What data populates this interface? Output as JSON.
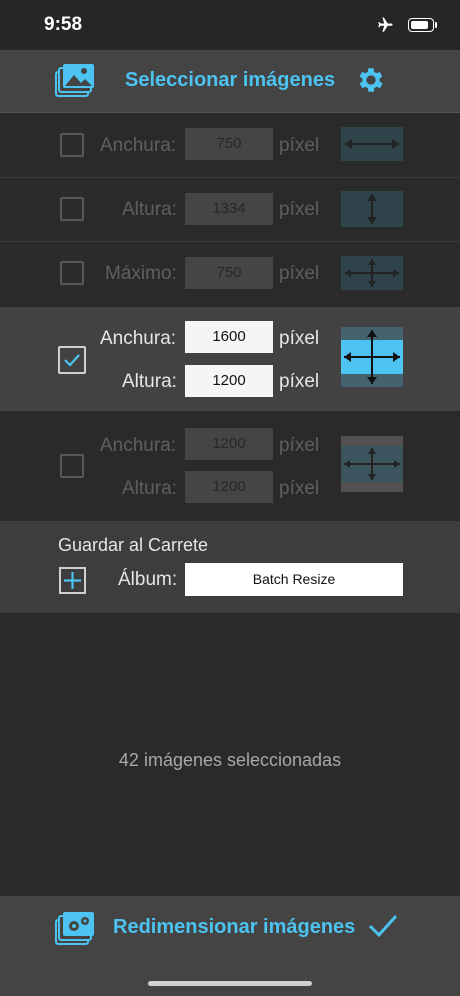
{
  "status": {
    "time": "9:58"
  },
  "header": {
    "title": "Seleccionar imágenes",
    "left_icon": "photo-stack-icon",
    "right_icon": "gear-icon"
  },
  "options": {
    "width": {
      "label": "Anchura:",
      "value": "750",
      "unit": "píxel",
      "checked": false
    },
    "height": {
      "label": "Altura:",
      "value": "1334",
      "unit": "píxel",
      "checked": false
    },
    "max": {
      "label": "Máximo:",
      "value": "750",
      "unit": "píxel",
      "checked": false
    },
    "both": {
      "checked": true,
      "width_label": "Anchura:",
      "width_value": "1600",
      "height_label": "Altura:",
      "height_value": "1200",
      "unit": "píxel"
    },
    "fixed": {
      "checked": false,
      "width_label": "Anchura:",
      "width_value": "1200",
      "height_label": "Altura:",
      "height_value": "1200",
      "unit": "píxel"
    }
  },
  "save": {
    "title": "Guardar al Carrete",
    "album_label": "Álbum:",
    "album_value": "Batch Resize"
  },
  "selection": {
    "count_text": "42 imágenes seleccionadas"
  },
  "footer": {
    "title": "Redimensionar imágenes",
    "icon": "photo-gears-icon",
    "confirm_icon": "checkmark-icon"
  },
  "colors": {
    "accent": "#4cc3f1",
    "background": "#2a2a2a",
    "bar": "#444444"
  }
}
